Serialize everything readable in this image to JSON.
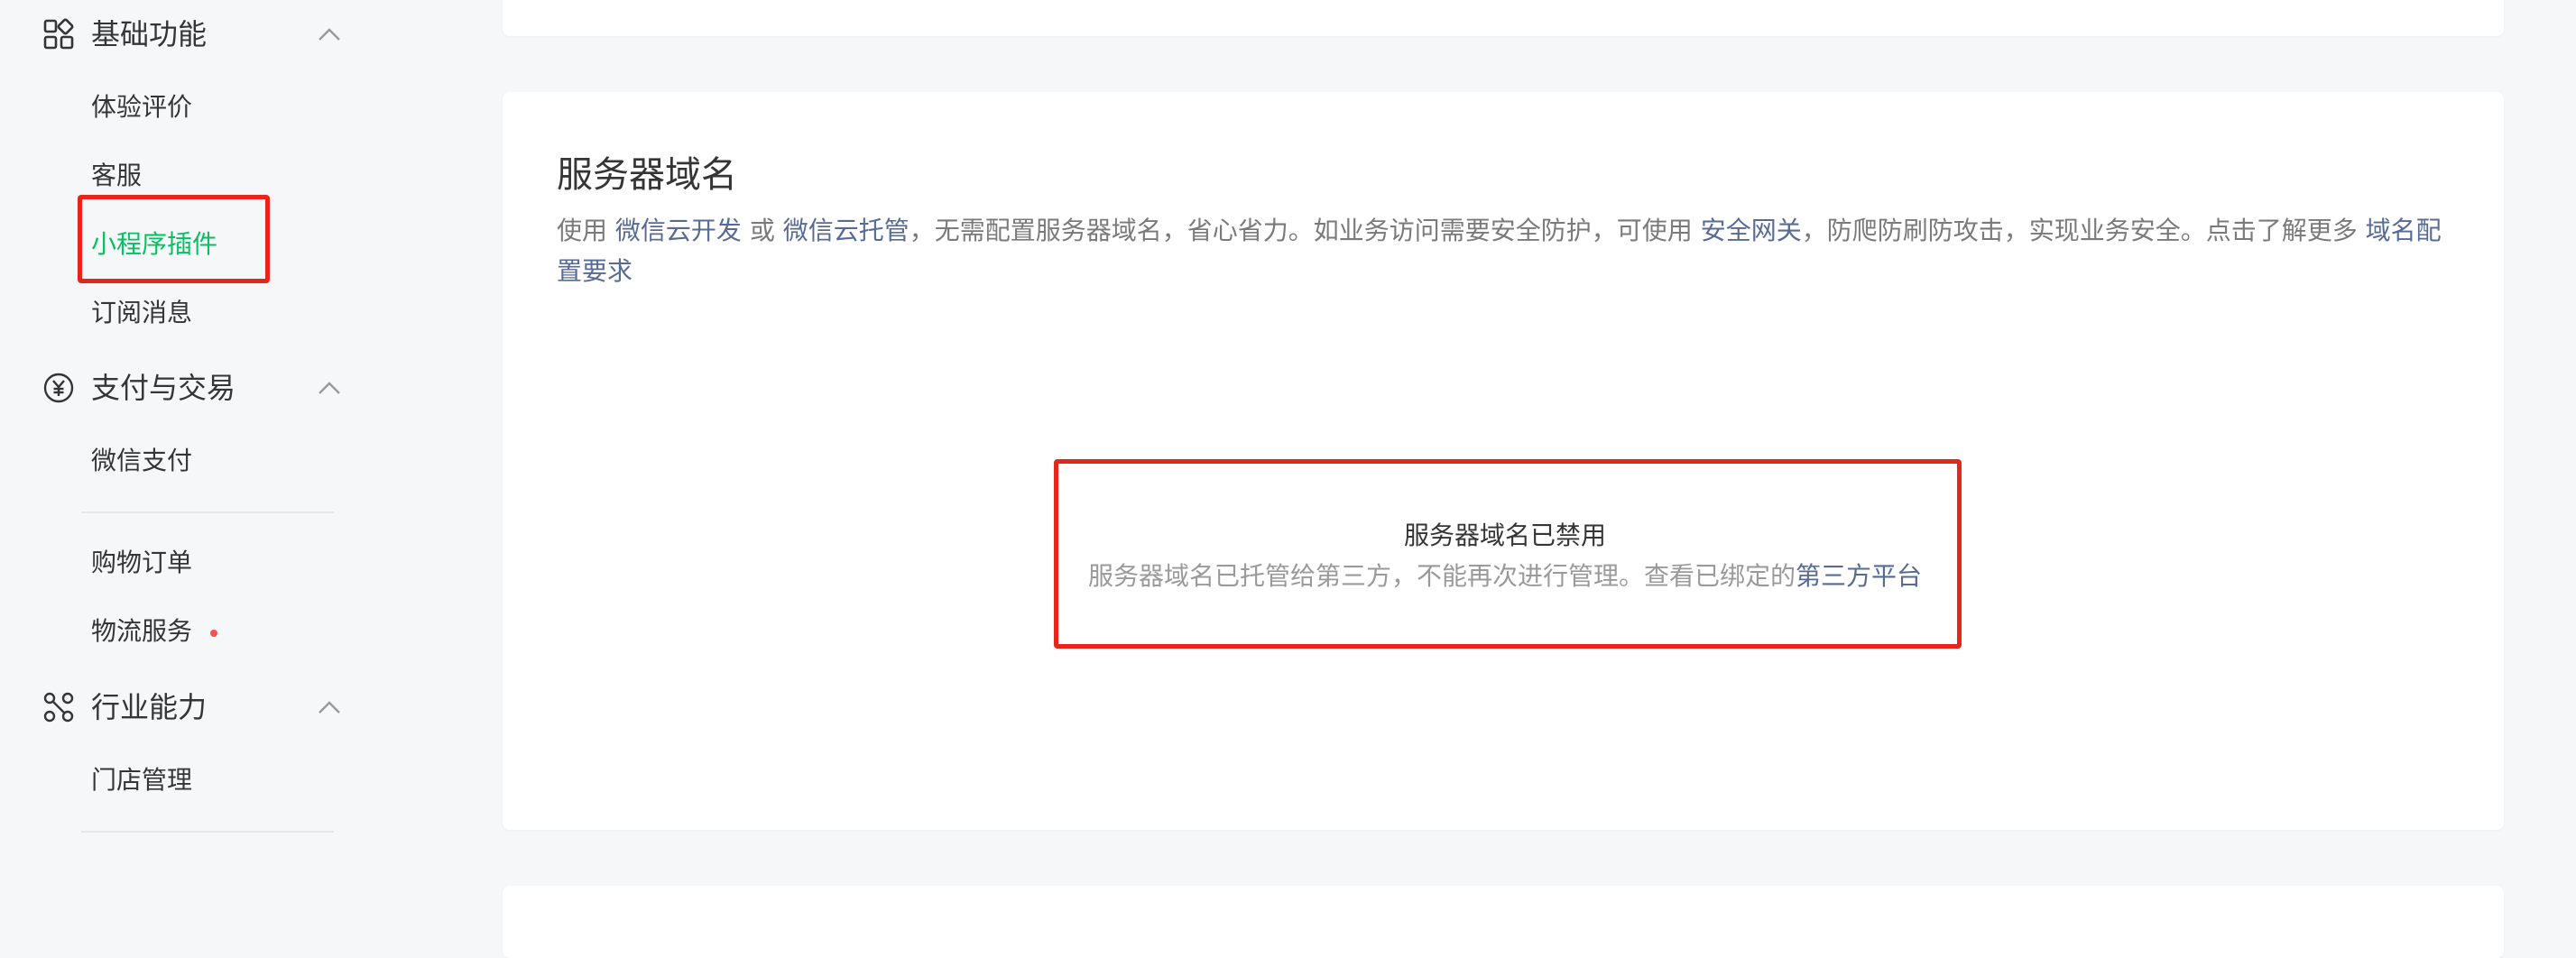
{
  "sidebar": {
    "sections": [
      {
        "title": "基础功能",
        "icon": "grid-icon",
        "items": [
          {
            "label": "体验评价"
          },
          {
            "label": "客服"
          },
          {
            "label": "小程序插件",
            "active": true
          },
          {
            "label": "订阅消息"
          }
        ]
      },
      {
        "title": "支付与交易",
        "icon": "yuan-circle-icon",
        "items": [
          {
            "label": "微信支付"
          },
          {
            "label": "购物订单"
          },
          {
            "label": "物流服务",
            "badge_dot": true
          }
        ]
      },
      {
        "title": "行业能力",
        "icon": "industry-nodes-icon",
        "items": [
          {
            "label": "门店管理"
          }
        ]
      }
    ]
  },
  "main": {
    "server_domain": {
      "title": "服务器域名",
      "desc": {
        "prefix": "使用",
        "link1": "微信云开发",
        "or_text": "或",
        "link2": "微信云托管",
        "middle": "，无需配置服务器域名，省心省力。如业务访问需要安全防护，可使用",
        "link3": "安全网关",
        "suffix": "，防爬防刷防攻击，实现业务安全。点击了解更多",
        "link4": "域名配置要求"
      },
      "empty_state": {
        "title": "服务器域名已禁用",
        "desc": "服务器域名已托管给第三方，不能再次进行管理。查看已绑定的",
        "link": "第三方平台"
      }
    }
  },
  "colors": {
    "accent_green": "#07c160",
    "link_blue": "#576b95",
    "highlight_red": "#e8251b",
    "dot_red": "#fa5151"
  }
}
